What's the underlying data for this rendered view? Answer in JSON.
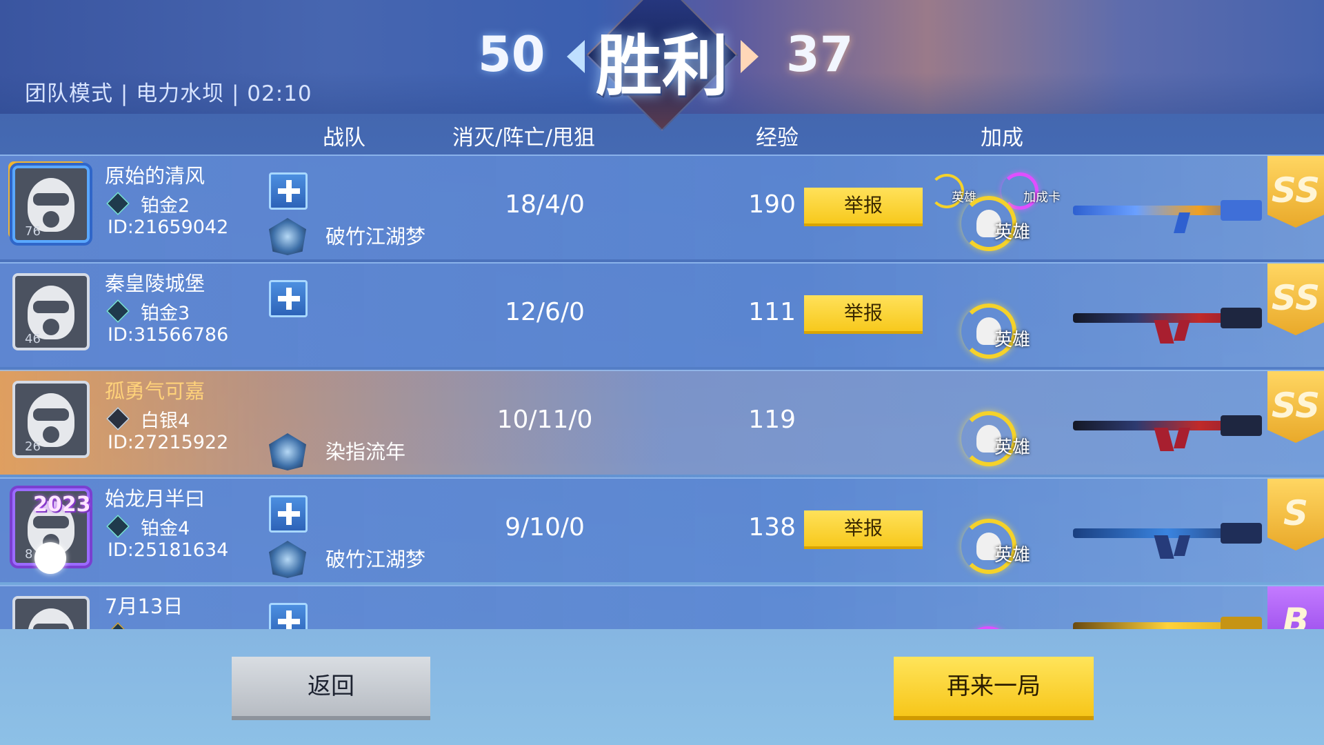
{
  "header": {
    "mode_info": "团队模式 | 电力水坝 | 02:10",
    "score_left": "50",
    "score_right": "37",
    "result": "胜利"
  },
  "columns": {
    "team": "战队",
    "kda": "消灭/阵亡/甩狙",
    "exp": "经验",
    "bonus": "加成"
  },
  "players": [
    {
      "name": "原始的清风",
      "rank": "铂金2",
      "id": "ID:21659042",
      "level": "76",
      "squad": "破竹江湖梦",
      "kda": "18/4/0",
      "exp": "190",
      "report": "举报",
      "bonus_label": "英雄",
      "small_bonus_label": "英雄",
      "card_label": "加成卡",
      "tier": "SS"
    },
    {
      "name": "秦皇陵城堡",
      "rank": "铂金3",
      "id": "ID:31566786",
      "level": "46",
      "squad": "",
      "kda": "12/6/0",
      "exp": "111",
      "report": "举报",
      "bonus_label": "英雄",
      "tier": "SS"
    },
    {
      "name": "孤勇气可嘉",
      "rank": "白银4",
      "id": "ID:27215922",
      "level": "26",
      "squad": "染指流年",
      "kda": "10/11/0",
      "exp": "119",
      "report": "",
      "bonus_label": "英雄",
      "tier": "SS"
    },
    {
      "name": "始龙月半曰",
      "rank": "铂金4",
      "id": "ID:25181634",
      "level": "8",
      "squad": "破竹江湖梦",
      "kda": "9/10/0",
      "exp": "138",
      "report": "举报",
      "bonus_label": "英雄",
      "tier": "S",
      "frame_tag": "2023"
    },
    {
      "name": "7月13日",
      "tier": "B"
    }
  ],
  "buttons": {
    "back": "返回",
    "again": "再来一局"
  },
  "colors": {
    "report_button": "#f7c91d",
    "bonus_ring": "#f5d22a",
    "card_ring": "#e04fff"
  }
}
